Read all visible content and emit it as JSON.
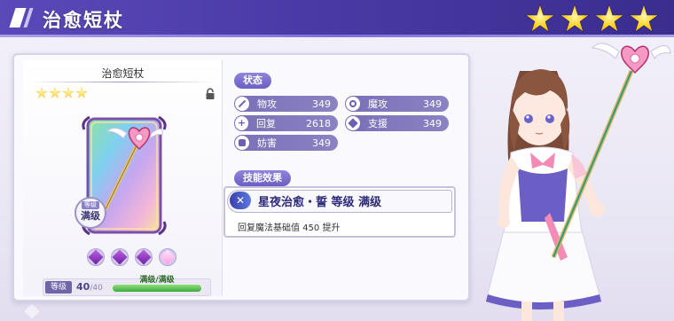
{
  "header": {
    "title": "治愈短杖",
    "rarity_stars": 4
  },
  "weapon": {
    "name": "治愈短杖",
    "rarity_stars": 4,
    "frame_badge_top": "等级",
    "frame_badge": "满级",
    "gems": [
      {
        "kind": "purple"
      },
      {
        "kind": "purple"
      },
      {
        "kind": "purple"
      },
      {
        "kind": "light"
      }
    ],
    "level_label": "等级",
    "level_current": "40",
    "level_max": "/40",
    "level_status": "满级/满级",
    "level_fraction": 1.0
  },
  "stats": {
    "section_label": "状态",
    "items": [
      {
        "icon": "sword-icon",
        "name": "物攻",
        "value": "349"
      },
      {
        "icon": "magic-staff-icon",
        "name": "魔攻",
        "value": "349"
      },
      {
        "icon": "heal-icon",
        "name": "回复",
        "value": "2618"
      },
      {
        "icon": "support-icon",
        "name": "支援",
        "value": "349"
      },
      {
        "icon": "hinder-icon",
        "name": "妨害",
        "value": "349"
      }
    ]
  },
  "skill": {
    "section_label": "技能效果",
    "title": "星夜治愈・誓 等级 满级",
    "description": "回复魔法基础值 450 提升"
  },
  "colors": {
    "header": "#4a3aa6",
    "accent": "#7a70b8",
    "star": "#ffd21c"
  }
}
